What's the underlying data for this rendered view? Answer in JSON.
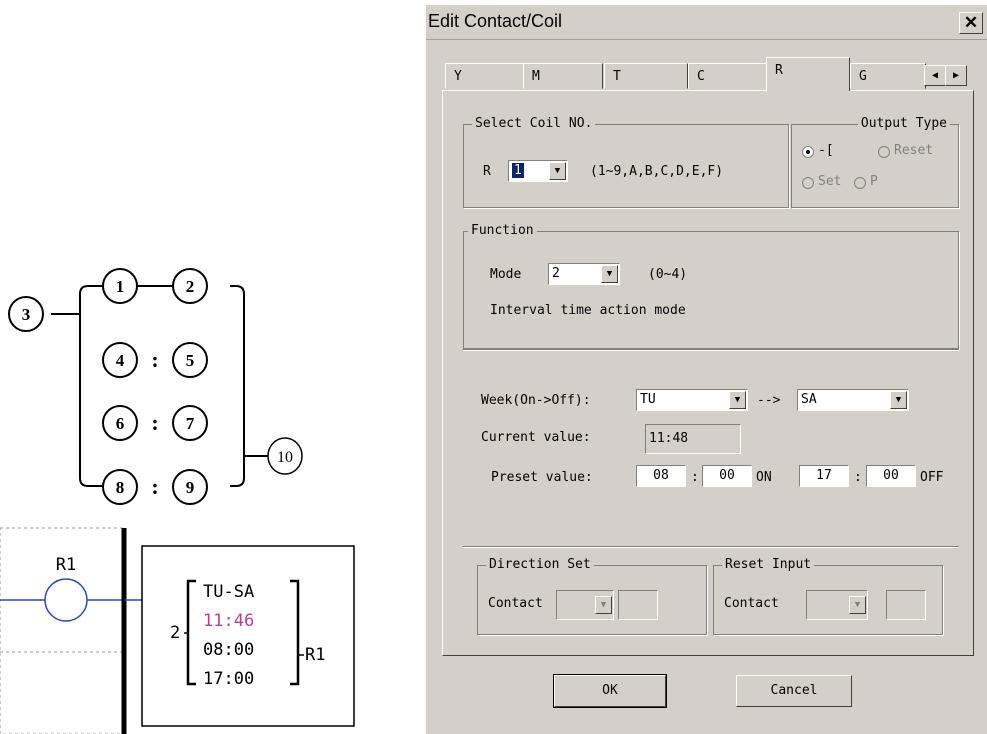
{
  "diagram": {
    "nodes": [
      "1",
      "2",
      "3",
      "4",
      "5",
      "6",
      "7",
      "8",
      "9",
      "10"
    ],
    "separator": ":"
  },
  "ladder": {
    "coil_label": "R1",
    "mode": "2",
    "days": "TU-SA",
    "current": "11:46",
    "on_time": "08:00",
    "off_time": "17:00",
    "output": "R1",
    "current_color": "#b040a0"
  },
  "dialog": {
    "title": "Edit Contact/Coil",
    "tabs": [
      "Y",
      "M",
      "T",
      "C",
      "R",
      "G"
    ],
    "active_tab": "R",
    "select_coil": {
      "legend": "Select Coil NO.",
      "prefix": "R",
      "value": "1",
      "range": "(1~9,A,B,C,D,E,F)"
    },
    "output_type": {
      "legend": "Output Type",
      "options": [
        "-[",
        "Reset",
        "Set",
        "P"
      ],
      "selected": "-["
    },
    "function": {
      "legend": "Function",
      "mode_label": "Mode",
      "mode_value": "2",
      "mode_range": "(0~4)",
      "description": "Interval time action mode"
    },
    "week": {
      "label": "Week(On->Off):",
      "from": "TU",
      "arrow": "-->",
      "to": "SA"
    },
    "current_value": {
      "label": "Current value:",
      "value": "11:48"
    },
    "preset_value": {
      "label": "Preset value:",
      "on_hour": "08",
      "on_min": "00",
      "on_label": "ON",
      "off_hour": "17",
      "off_min": "00",
      "off_label": "OFF",
      "colon": ":"
    },
    "direction_set": {
      "legend": "Direction Set",
      "contact_label": "Contact"
    },
    "reset_input": {
      "legend": "Reset Input",
      "contact_label": "Contact"
    },
    "buttons": {
      "ok": "OK",
      "cancel": "Cancel"
    }
  }
}
